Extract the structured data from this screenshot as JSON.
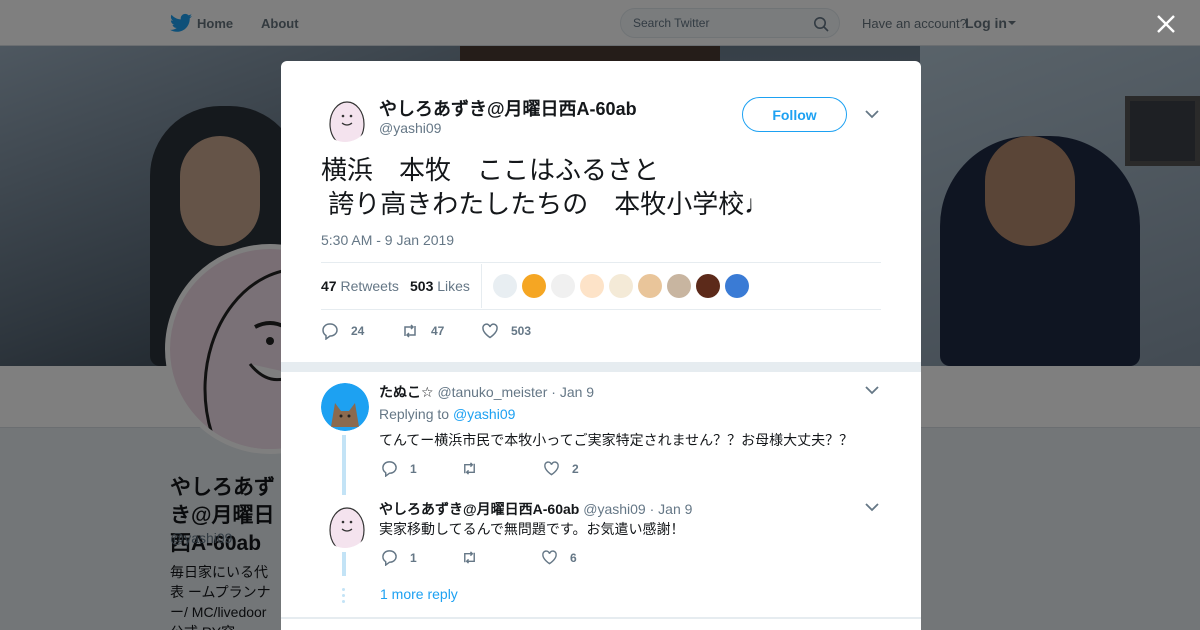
{
  "nav": {
    "home_label": "Home",
    "about_label": "About",
    "search_placeholder": "Search Twitter",
    "have_account": "Have an account?",
    "login_label": "Log in",
    "brand_color": "#1da1f2"
  },
  "profile": {
    "name": "やしろあずき@月曜日西A-60ab",
    "handle": "@yashi09",
    "bio": "毎日家にいる代表 ームプランナー/ MC/livedoor公式 RY突破！/web"
  },
  "tweet": {
    "author_name": "やしろあずき@月曜日西A-60ab",
    "author_handle": "@yashi09",
    "follow_label": "Follow",
    "text": "横浜　本牧　ここはふるさと\n 誇り高きわたしたちの　本牧小学校♩",
    "timestamp": "5:30 AM - 9 Jan 2019",
    "retweets_count": "47",
    "retweets_label": "Retweets",
    "likes_count": "503",
    "likes_label": "Likes",
    "actions": {
      "reply_count": "24",
      "retweet_count": "47",
      "like_count": "503"
    },
    "liker_colors": [
      "#e8eef2",
      "#f5a623",
      "#f0f0f0",
      "#fde3c8",
      "#f4ead7",
      "#e9c59a",
      "#c8b5a0",
      "#5c2a1a",
      "#3a7bd5"
    ]
  },
  "replies": [
    {
      "name": "たぬこ☆",
      "handle": "@tanuko_meister",
      "date": "Jan 9",
      "replying_to_label": "Replying to",
      "replying_to": "@yashi09",
      "text": "てんてー横浜市民で本牧小ってご実家特定されません？？お母様大丈夫？？",
      "reply_count": "1",
      "retweet_count": "",
      "like_count": "2"
    },
    {
      "name": "やしろあずき@月曜日西A-60ab",
      "handle": "@yashi09",
      "date": "Jan 9",
      "text": "実家移動してるんで無問題です。お気遣い感謝！",
      "reply_count": "1",
      "retweet_count": "",
      "like_count": "6"
    }
  ],
  "more_replies_label": "1 more reply"
}
